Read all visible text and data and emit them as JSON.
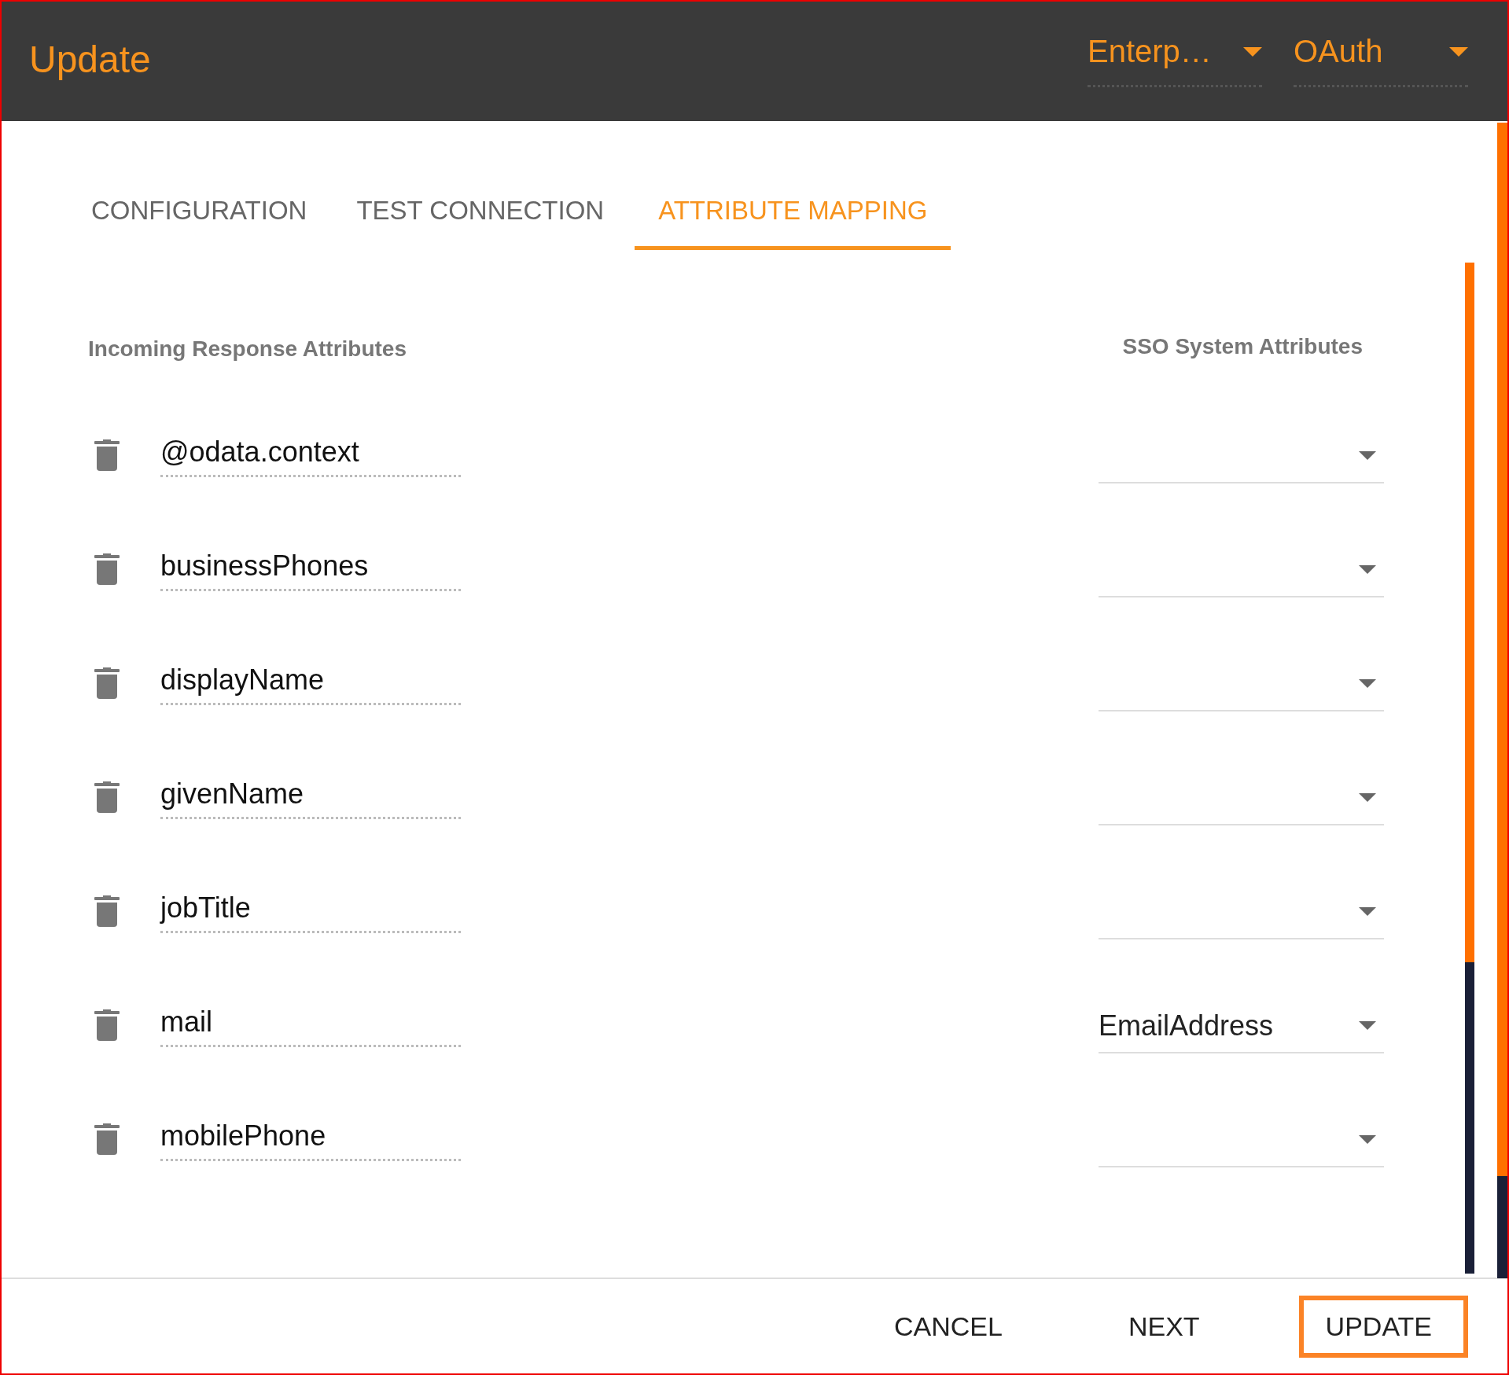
{
  "header": {
    "title": "Update",
    "dropdowns": [
      {
        "value": "Enterp…"
      },
      {
        "value": "OAuth"
      }
    ]
  },
  "tabs": [
    {
      "label": "CONFIGURATION",
      "selected": false
    },
    {
      "label": "TEST CONNECTION",
      "selected": false
    },
    {
      "label": "ATTRIBUTE MAPPING",
      "selected": true
    }
  ],
  "columns": {
    "left": "Incoming Response Attributes",
    "right": "SSO System Attributes"
  },
  "rows": [
    {
      "attribute": "@odata.context",
      "mapping": ""
    },
    {
      "attribute": "businessPhones",
      "mapping": ""
    },
    {
      "attribute": "displayName",
      "mapping": ""
    },
    {
      "attribute": "givenName",
      "mapping": ""
    },
    {
      "attribute": "jobTitle",
      "mapping": ""
    },
    {
      "attribute": "mail",
      "mapping": "EmailAddress"
    },
    {
      "attribute": "mobilePhone",
      "mapping": ""
    }
  ],
  "buttons": [
    {
      "label": "CANCEL",
      "highlighted": false
    },
    {
      "label": "NEXT",
      "highlighted": false
    },
    {
      "label": "UPDATE",
      "highlighted": true
    }
  ]
}
